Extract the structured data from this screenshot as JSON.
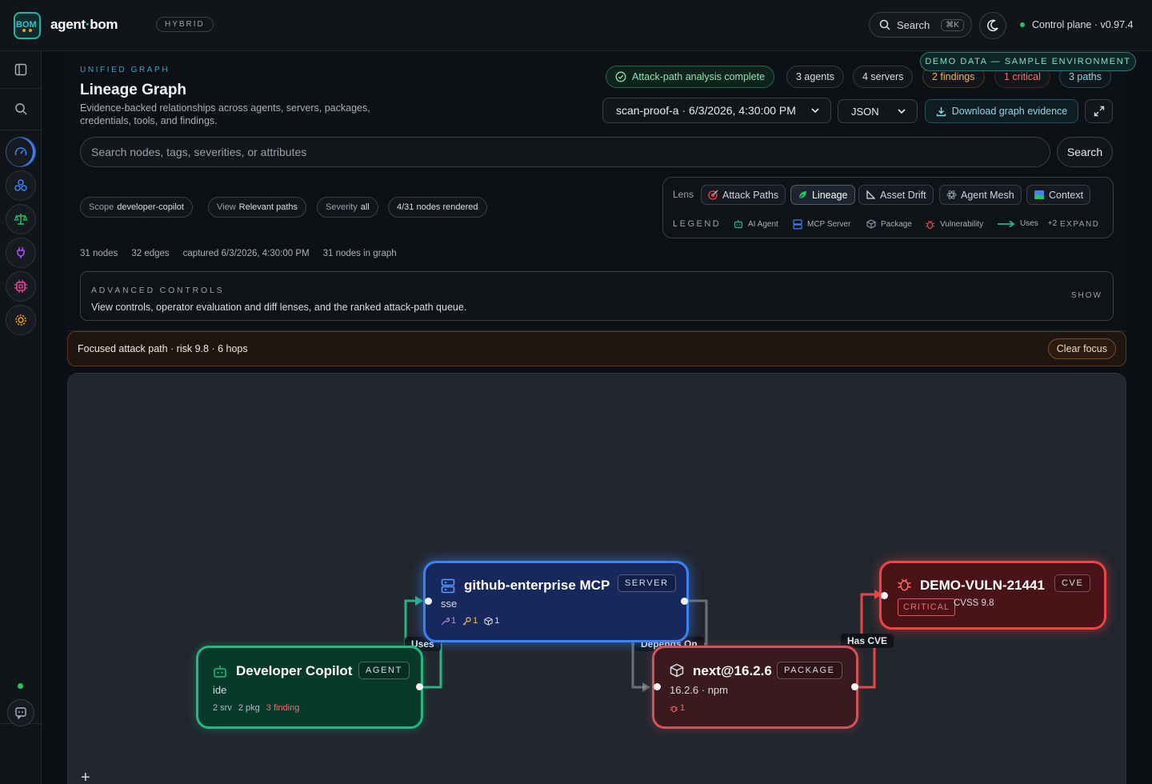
{
  "app": {
    "brand_prefix": "agent",
    "brand_dot": "·",
    "brand_suffix": "bom",
    "logo_text": "BOM",
    "mode": "HYBRID",
    "search_label": "Search",
    "search_shortcut": "⌘K",
    "control_plane": "Control plane · v0.97.4",
    "accent": "#2ec4c9"
  },
  "sidebar": {
    "items": [
      {
        "icon": "panel-toggle-icon"
      },
      {
        "icon": "search-icon"
      },
      {
        "icon": "dashboard-gauge-icon",
        "color": "#3b82f6"
      },
      {
        "icon": "graph-nodes-icon",
        "color": "#3b82f6"
      },
      {
        "icon": "scales-icon",
        "color": "#22c55e"
      },
      {
        "icon": "plug-icon",
        "color": "#a855f7"
      },
      {
        "icon": "chip-icon",
        "color": "#ec4899"
      },
      {
        "icon": "gear-icon",
        "color": "#f59e0b"
      }
    ],
    "chat_icon": "chat-icon"
  },
  "demo_banner": "DEMO DATA — SAMPLE ENVIRONMENT",
  "header": {
    "eyebrow": "UNIFIED GRAPH",
    "title": "Lineage Graph",
    "subtitle": "Evidence-backed relationships across agents, servers, packages, credentials, tools, and findings.",
    "status": "Attack-path analysis complete",
    "agents": "3 agents",
    "servers": "4 servers",
    "findings": "2 findings",
    "critical": "1 critical",
    "paths": "3 paths",
    "scan_select": "scan-proof-a · 6/3/2026, 4:30:00 PM",
    "format_select": "JSON",
    "download": "Download graph evidence"
  },
  "search": {
    "placeholder": "Search nodes, tags, severities, or attributes",
    "button": "Search"
  },
  "chips": {
    "scope_label": "Scope",
    "scope_value": "developer-copilot",
    "view_label": "View",
    "view_value": "Relevant paths",
    "severity_label": "Severity",
    "severity_value": "all",
    "rendered": "4/31 nodes rendered"
  },
  "lens": {
    "label": "Lens",
    "options": [
      "Attack Paths",
      "Lineage",
      "Asset Drift",
      "Agent Mesh",
      "Context"
    ],
    "selected": "Lineage"
  },
  "legend": {
    "label": "LEGEND",
    "items": [
      "AI Agent",
      "MCP Server",
      "Package",
      "Vulnerability",
      "Uses"
    ],
    "more": "+2",
    "expand": "EXPAND"
  },
  "stats": {
    "nodes": "31 nodes",
    "edges": "32 edges",
    "captured": "captured 6/3/2026, 4:30:00 PM",
    "in_graph": "31 nodes in graph"
  },
  "advanced": {
    "eyebrow": "ADVANCED CONTROLS",
    "description": "View controls, operator evaluation and diff lenses, and the ranked attack-path queue.",
    "toggle": "SHOW"
  },
  "focus": {
    "text": "Focused attack path · risk 9.8 · 6 hops",
    "clear": "Clear focus"
  },
  "graph": {
    "edges": {
      "uses": "Uses",
      "depends_on": "Depends On",
      "has_cve": "Has CVE"
    },
    "agent": {
      "title": "Developer Copilot",
      "type": "AGENT",
      "sub": "ide",
      "srv": "2 srv",
      "pkg": "2 pkg",
      "findings": "3 finding"
    },
    "server": {
      "title": "github-enterprise MCP",
      "type": "SERVER",
      "sub": "sse",
      "tools": "1",
      "creds": "1",
      "packages": "1"
    },
    "package": {
      "title": "next@16.2.6",
      "type": "PACKAGE",
      "sub": "16.2.6 · npm",
      "vulns": "1"
    },
    "cve": {
      "title": "DEMO-VULN-21441",
      "type": "CVE",
      "severity": "CRITICAL",
      "cvss": "CVSS 9.8"
    },
    "zoom_in": "+"
  }
}
